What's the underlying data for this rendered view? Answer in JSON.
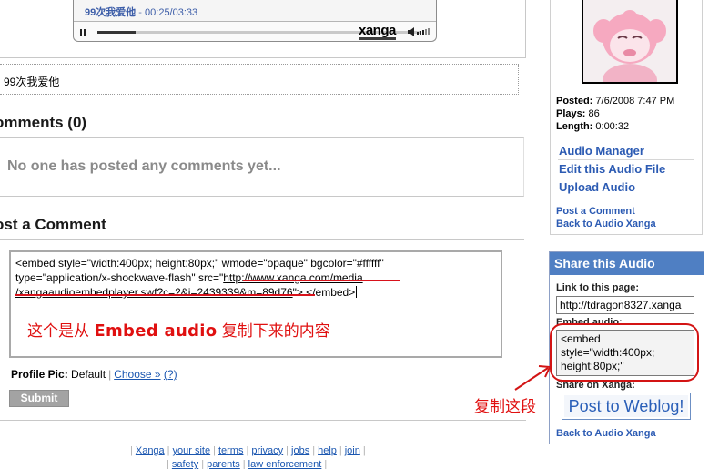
{
  "player": {
    "track_title": "99次我爱他",
    "separator": " - ",
    "time": "00:25/03:33",
    "logo": "xanga",
    "progress_fraction": 0.117,
    "pause_icon": "pause-icon",
    "volume_icon": "volume-icon"
  },
  "caption": "99次我爱他",
  "comments": {
    "title": "omments (0)",
    "empty_message": "No one has posted any comments yet..."
  },
  "post_comment": {
    "title": "ost a Comment",
    "textarea_line1": "<embed style=\"width:400px; height:80px;\" wmode=\"opaque\" bgcolor=\"#ffffff\"",
    "textarea_line2_a": "type=\"application/x-shockwave-flash\" src=\"",
    "textarea_url_a": "http://www.xanga.com/media",
    "textarea_url_b": "/xangaaudioembedplayer.swf?c=2&i=2439339&m=89d76",
    "textarea_line3_b": "\"> </embed>",
    "annotation_a": "这个是从 ",
    "annotation_bold": "Embed audio",
    "annotation_b": " 复制下来的内容",
    "profile_label": "Profile Pic:",
    "profile_value": "Default",
    "choose_link": "Choose »",
    "help_link": "(?)",
    "submit_label": "Submit"
  },
  "footer": {
    "row1": [
      "Xanga",
      "your site",
      "terms",
      "privacy",
      "jobs",
      "help",
      "join"
    ],
    "row2": [
      "safety",
      "parents",
      "law enforcement"
    ]
  },
  "sidebar": {
    "posted_label": "Posted:",
    "posted_value": "7/6/2008 7:47 PM",
    "plays_label": "Plays:",
    "plays_value": "86",
    "length_label": "Length:",
    "length_value": "0:00:32",
    "links": [
      "Audio Manager",
      "Edit this Audio File",
      "Upload Audio"
    ],
    "small_links": [
      "Post a Comment",
      "Back to Audio Xanga"
    ]
  },
  "share": {
    "header": "Share this Audio",
    "link_label": "Link to this page:",
    "link_value": "http://tdragon8327.xanga",
    "embed_label": "Embed audio:",
    "embed_value_1": "<embed",
    "embed_value_2": "style=\"width:400px;",
    "embed_value_3": "height:80px;\"",
    "share_on_label": "Share on Xanga:",
    "weblog_button": "Post to Weblog!",
    "back_link": "Back to Audio Xanga"
  },
  "annotation_copy": "复制这段",
  "colors": {
    "accent": "#4f7fc3",
    "link": "#2c5bb3",
    "annotation": "#e01010"
  }
}
